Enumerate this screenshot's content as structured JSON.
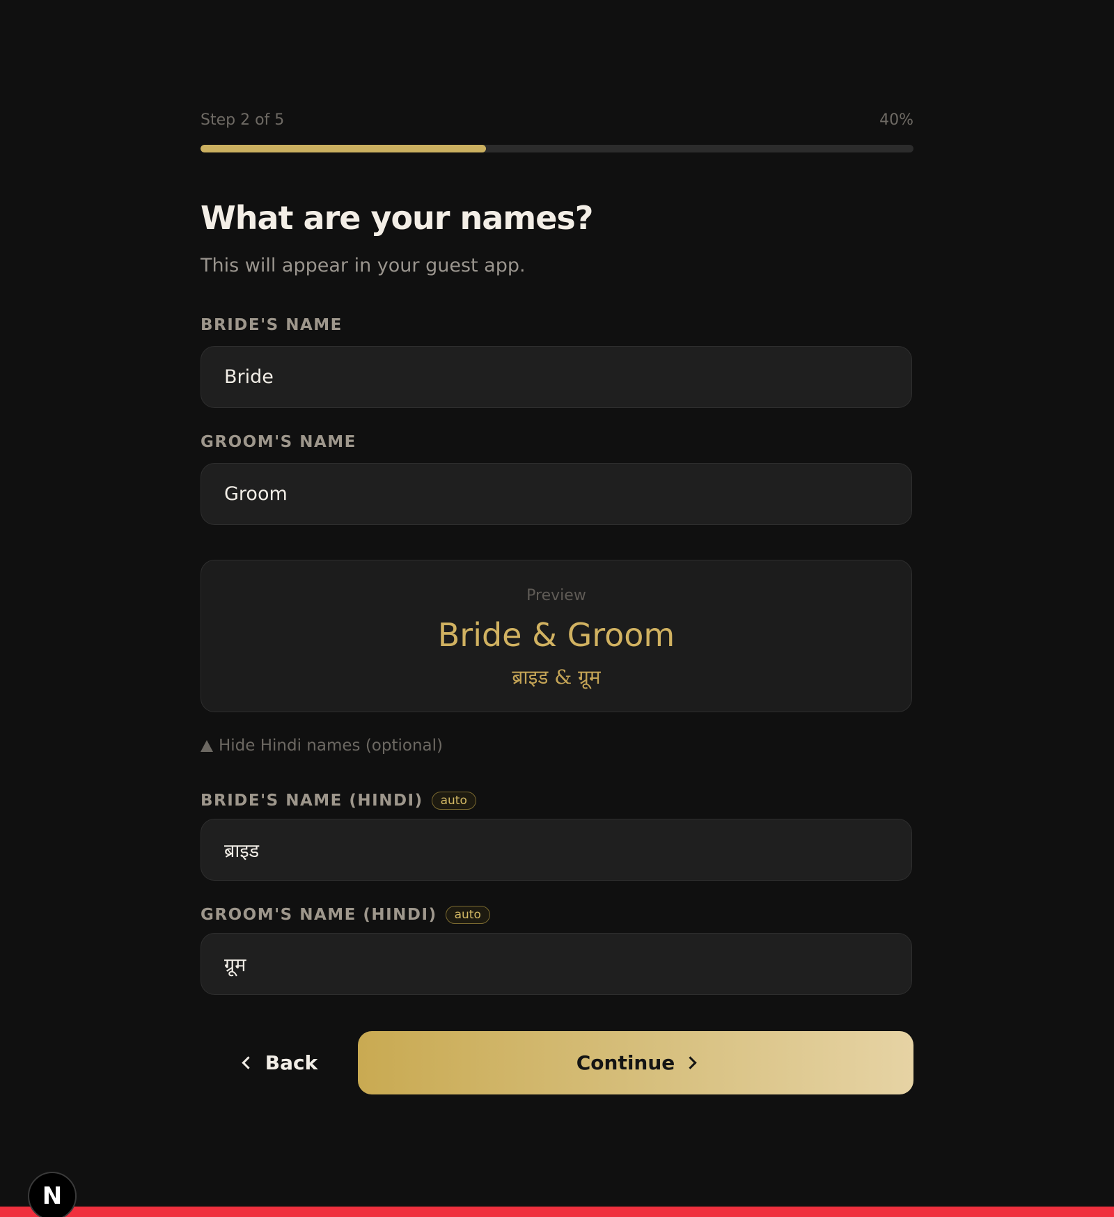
{
  "progress": {
    "step_text": "Step 2 of 5",
    "percent_text": "40%",
    "fraction": 0.4
  },
  "header": {
    "title": "What are your names?",
    "subtitle": "This will appear in your guest app."
  },
  "form": {
    "bride_label": "BRIDE'S NAME",
    "bride_value": "Bride",
    "groom_label": "GROOM'S NAME",
    "groom_value": "Groom",
    "bride_hindi_label": "BRIDE'S NAME (HINDI)",
    "bride_hindi_badge": "auto",
    "bride_hindi_value": "ब्राइड",
    "groom_hindi_label": "GROOM'S NAME (HINDI)",
    "groom_hindi_badge": "auto",
    "groom_hindi_value": "ग्रूम"
  },
  "preview": {
    "label": "Preview",
    "names": "Bride & Groom",
    "hindi_names": "ब्राइड & ग्रूम"
  },
  "toggle": {
    "label": "Hide Hindi names (optional)",
    "icon": "triangle-up-icon"
  },
  "actions": {
    "back_label": "Back",
    "continue_label": "Continue"
  },
  "dev_badge": {
    "letter": "N"
  },
  "colors": {
    "background": "#101010",
    "accent": "#cbb060",
    "field_bg": "#1f1f1f",
    "error_bar": "#f0303e"
  }
}
